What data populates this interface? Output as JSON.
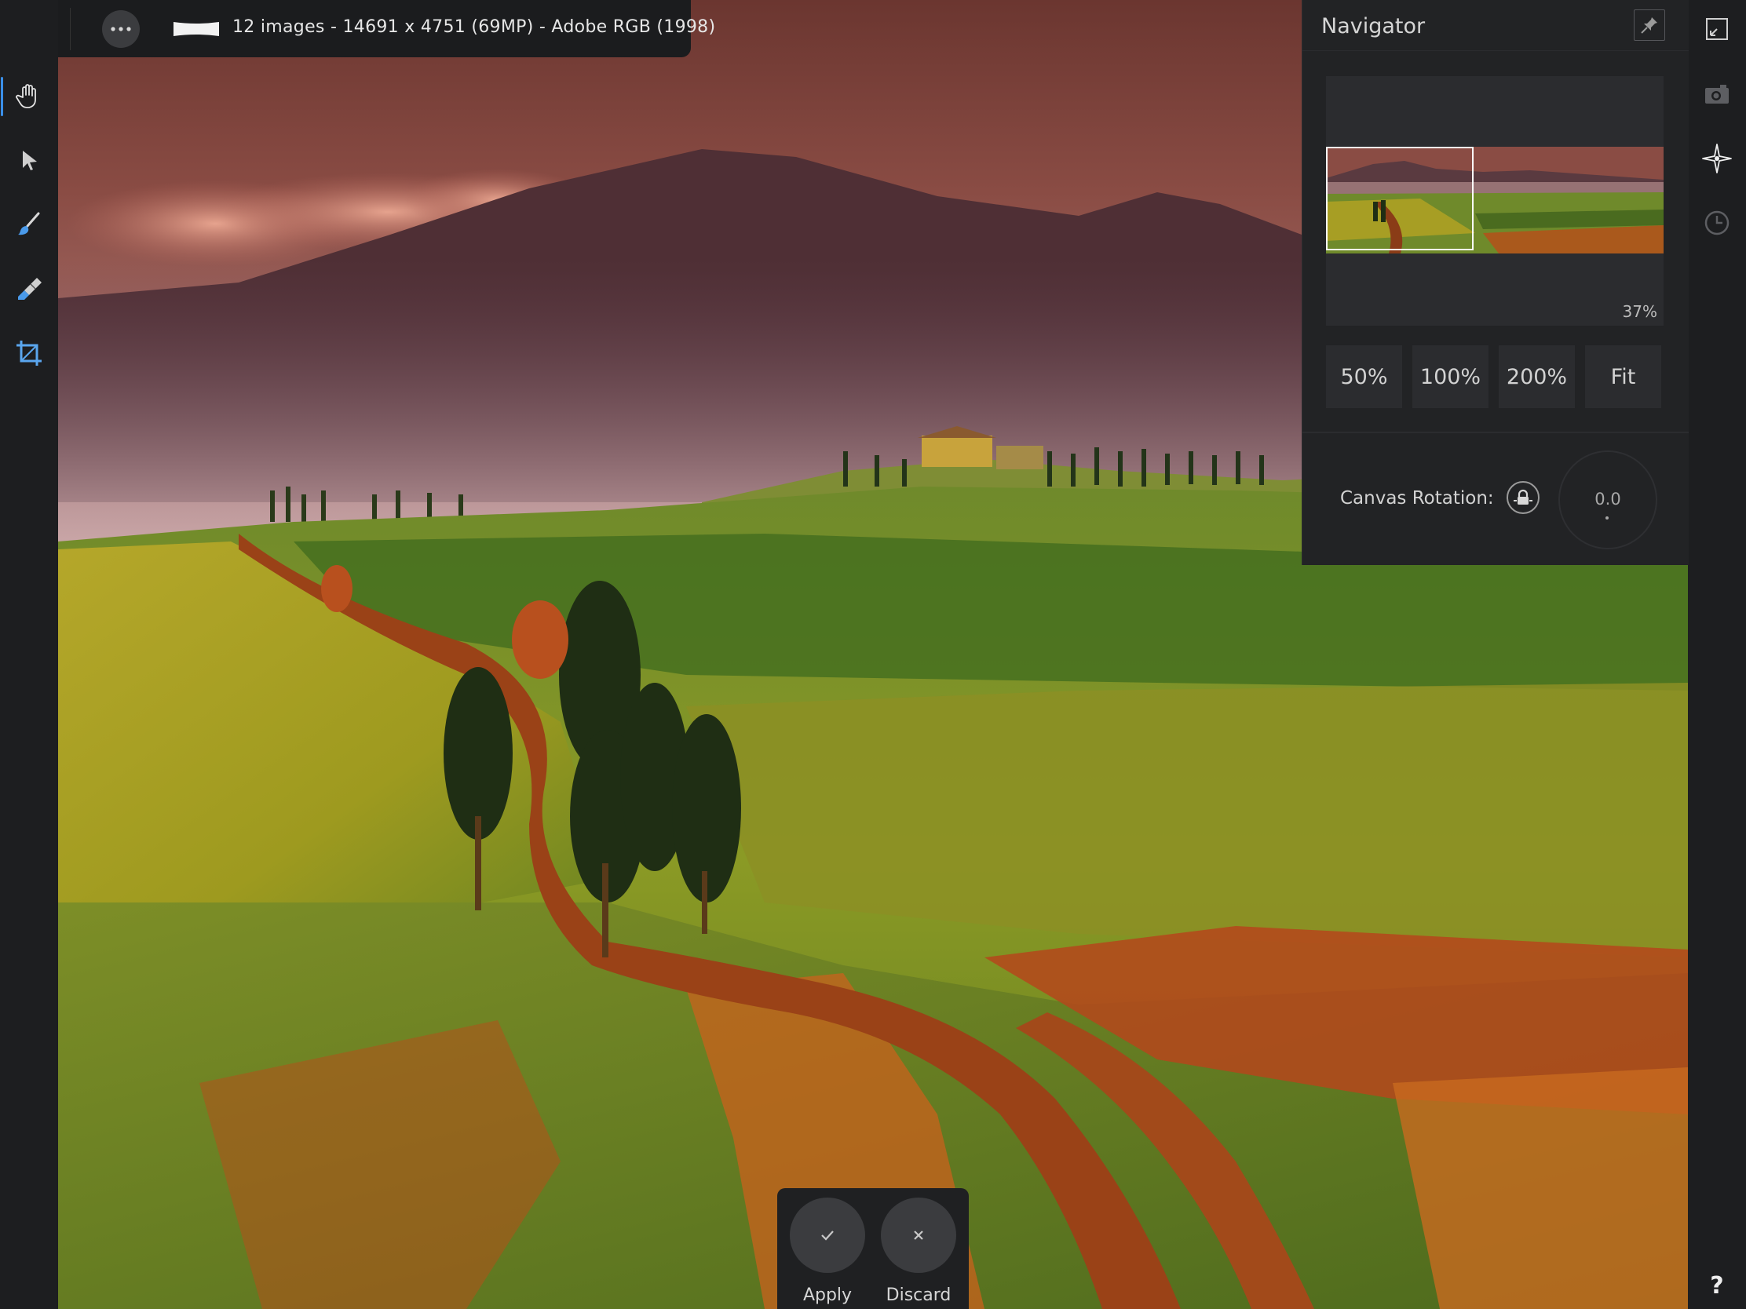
{
  "header": {
    "back_icon": "arrow-left-icon",
    "more_icon": "ellipsis-icon",
    "document_info": "12 images - 14691 x 4751 (69MP) - Adobe RGB (1998)"
  },
  "left_toolbar": {
    "active_tool": "view",
    "tools": [
      {
        "id": "view",
        "icon": "hand-icon"
      },
      {
        "id": "move",
        "icon": "arrow-pointer-icon"
      },
      {
        "id": "source",
        "icon": "brush-icon"
      },
      {
        "id": "eraser",
        "icon": "eraser-brush-icon"
      },
      {
        "id": "crop",
        "icon": "crop-icon"
      }
    ]
  },
  "right_toolbar": {
    "items": [
      {
        "id": "fullscreen",
        "icon": "fullscreen-icon"
      },
      {
        "id": "snapshot",
        "icon": "camera-icon"
      },
      {
        "id": "navigator",
        "icon": "compass-star-icon"
      },
      {
        "id": "history",
        "icon": "clock-icon"
      }
    ],
    "help_label": "?"
  },
  "navigator": {
    "title": "Navigator",
    "pin_icon": "pin-icon",
    "zoom_readout": "37%",
    "zoom_buttons": [
      "50%",
      "100%",
      "200%",
      "Fit"
    ],
    "canvas_rotation_label": "Canvas Rotation:",
    "rotation_lock_icon": "lock-icon",
    "rotation_value": "0.0"
  },
  "actions": {
    "apply_label": "Apply",
    "apply_icon": "checkmark-icon",
    "discard_label": "Discard",
    "discard_icon": "close-icon"
  },
  "colors": {
    "accent": "#3a8fe8",
    "panel": "#222325",
    "toolbar": "#1d1e20"
  }
}
